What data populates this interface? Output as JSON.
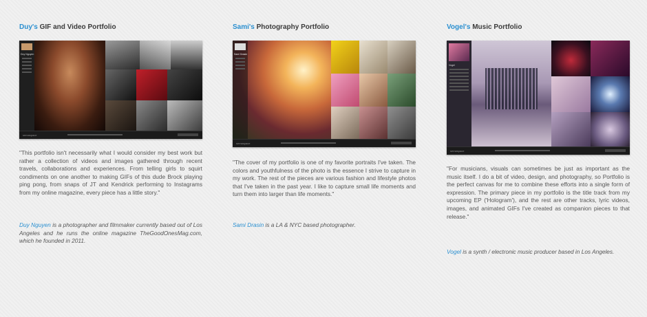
{
  "columns": [
    {
      "heading_name": "Duy's",
      "heading_rest": " GIF and Video Portfolio",
      "quote": "\"This portfolio isn't necessarily what I would consider my best work but rather a collection of videos and images gathered through recent travels, collaborations and experiences. From telling girls to squirt condiments on one another to making GIFs of this dude Brock playing ping pong, from snaps of JT and Kendrick performing to Instagrams from my online magazine, every piece has a little story.\"",
      "bio_link": "Duy Nguyen",
      "bio_rest": " is a photographer and filmmaker currently based out of Los Angeles and he runs the online magazine TheGoodOnesMag.com, which he founded in 2011.",
      "sidebar_name": "Duy Nguyen",
      "bar_label": "semaspace"
    },
    {
      "heading_name": "Sami's",
      "heading_rest": " Photography Portfolio",
      "quote": "\"The cover of my portfolio is one of my favorite portraits I've taken. The colors and youthfulness of the photo is the essence I strive to capture in my work. The rest of the pieces are various fashion and lifestyle photos that I've taken in the past year. I like to capture small life moments and turn them into larger than life moments.\"",
      "bio_link": "Sami Drasin",
      "bio_rest": " is a LA & NYC based photographer.",
      "sidebar_name": "Sami Drasin",
      "bar_label": "semaspace"
    },
    {
      "heading_name": "Vogel's",
      "heading_rest": " Music Portfolio",
      "quote": "\"For musicians, visuals can sometimes be just as important as the music itself.  I do a bit of video, design, and photography, so Portfolio is the perfect canvas for me to combine these efforts into a single form of expression.  The primary piece in my portfolio is the title track from my upcoming EP ('Hologram'), and the rest are other tracks, lyric videos, images, and animated GIFs I've created as companion pieces to that release.\"",
      "bio_link": "Vogel",
      "bio_rest": " is a synth / electronic music producer based in Los Angeles.",
      "sidebar_name": "Vogel",
      "bar_label": "semaspace"
    }
  ]
}
